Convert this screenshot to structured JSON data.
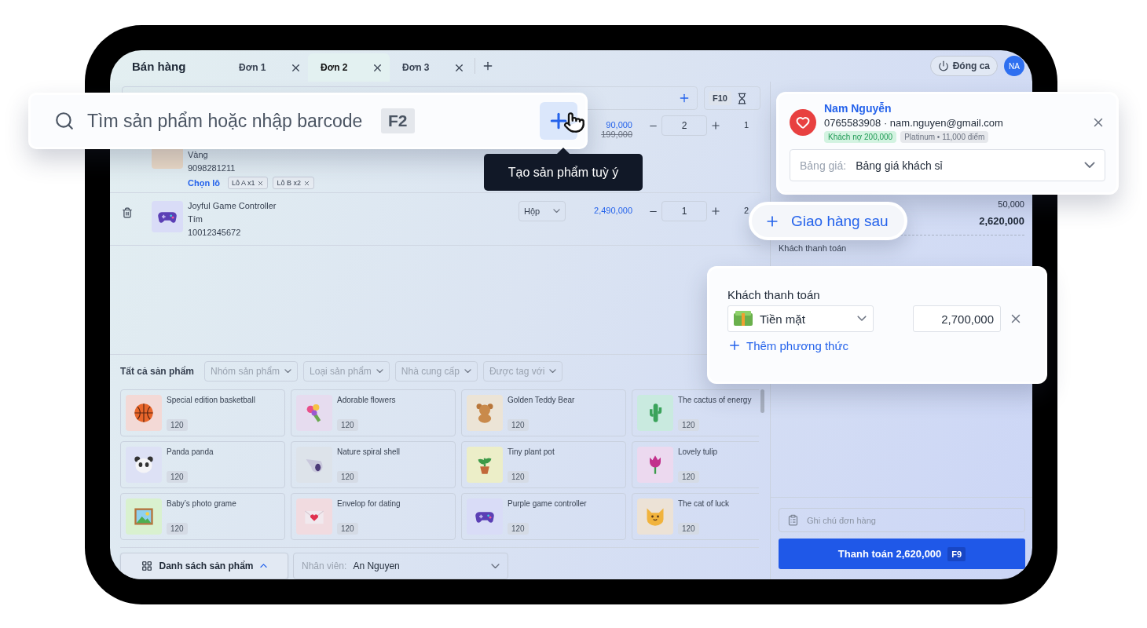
{
  "app": {
    "title": "Bán hàng"
  },
  "tabs": [
    {
      "label": "Đơn 1",
      "selected": false
    },
    {
      "label": "Đơn 2",
      "selected": true
    },
    {
      "label": "Đơn 3",
      "selected": false
    }
  ],
  "header": {
    "close_shift": "Đóng ca",
    "avatar": "NA"
  },
  "toolbar": {
    "scale_key": "F10"
  },
  "cart": [
    {
      "variant": "Vàng",
      "code": "9098281211",
      "lot_link": "Chọn lô",
      "lots": [
        "Lô A x1",
        "Lô B x2"
      ],
      "price": "90,000",
      "original_price": "199,000",
      "quantity": "2",
      "total": "1",
      "color": "#ead9c6"
    },
    {
      "name": "Joyful Game Controller",
      "variant": "Tím",
      "code": "10012345672",
      "unit": "Hộp",
      "price": "2,490,000",
      "quantity": "1",
      "total": "2",
      "color": "#d9dcf7"
    }
  ],
  "products": {
    "title": "Tất cả sản phẩm",
    "filters": [
      "Nhóm sản phẩm",
      "Loại sản phẩm",
      "Nhà cung cấp",
      "Được tag với"
    ],
    "items": [
      {
        "name": "Special edition basketball",
        "stock": "120",
        "color": "#f3d9d6"
      },
      {
        "name": "Adorable flowers",
        "stock": "120",
        "color": "#e6dcef"
      },
      {
        "name": "Golden Teddy Bear",
        "stock": "120",
        "color": "#ece4d6"
      },
      {
        "name": "The cactus of energy",
        "stock": "120",
        "color": "#c9eadf"
      },
      {
        "name": "Panda panda",
        "stock": "120",
        "color": "#dde1f5"
      },
      {
        "name": "Nature spiral shell",
        "stock": "120",
        "color": "#dde3ea"
      },
      {
        "name": "Tiny plant pot",
        "stock": "120",
        "color": "#eceec8"
      },
      {
        "name": "Lovely tulip",
        "stock": "120",
        "color": "#ecd9ef"
      },
      {
        "name": "Baby’s photo grame",
        "stock": "120",
        "color": "#d9f1cf"
      },
      {
        "name": "Envelop for dating",
        "stock": "120",
        "color": "#f1dbe0"
      },
      {
        "name": "Purple game controller",
        "stock": "120",
        "color": "#d9dcf7"
      },
      {
        "name": "The cat of luck",
        "stock": "120",
        "color": "#ece2d6"
      }
    ]
  },
  "bottom_bar": {
    "list_button": "Danh sách sản phẩm",
    "staff_label": "Nhân viên:",
    "staff": "An Nguyen"
  },
  "summary": {
    "row_1": "50,000",
    "total": "2,620,000",
    "payment_label": "Khách thanh toán"
  },
  "order_note": {
    "placeholder": "Ghi chú đơn hàng"
  },
  "checkout": {
    "label": "Thanh toán 2,620,000",
    "key": "F9"
  },
  "search_popup": {
    "placeholder": "Tìm sản phẩm hoặc nhập barcode",
    "key": "F2",
    "tooltip": "Tạo sản phẩm tuỳ ý"
  },
  "customer_card": {
    "name": "Nam Nguyễn",
    "contact": "0765583908 · nam.nguyen@gmail.com",
    "badges": [
      {
        "label": "Khách nợ 200,000",
        "kind": "debt"
      },
      {
        "label": "Platinum • 11,000 điểm",
        "kind": "tier"
      }
    ],
    "price_list_label": "Bảng giá:",
    "price_list": "Bảng giá khách sỉ"
  },
  "delivery_button": {
    "label": "Giao hàng sau"
  },
  "payment_card": {
    "label": "Khách thanh toán",
    "method": "Tiền mặt",
    "amount": "2,700,000",
    "add_method": "Thêm phương thức"
  }
}
